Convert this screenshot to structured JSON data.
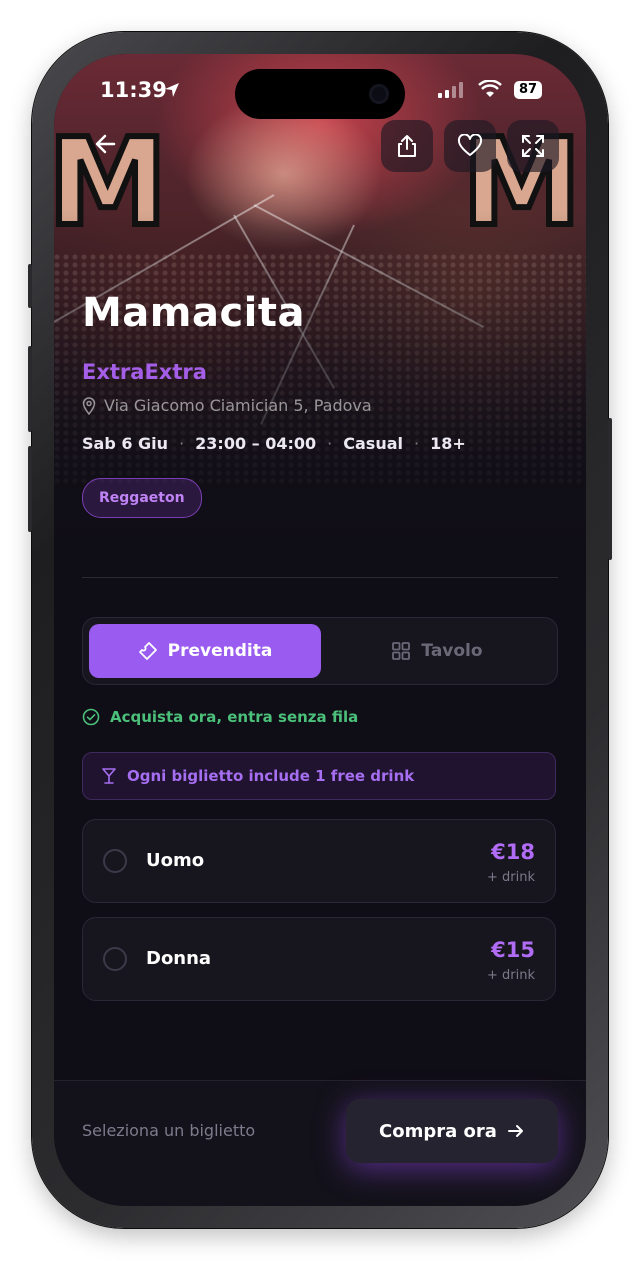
{
  "status_bar": {
    "time": "11:39",
    "battery": "87"
  },
  "event": {
    "title": "Mamacita",
    "venue": "ExtraExtra",
    "address": "Via Giacomo Ciamician 5, Padova",
    "date": "Sab 6 Giu",
    "time_range": "23:00 – 04:00",
    "dress_code": "Casual",
    "age": "18+",
    "genre": "Reggaeton",
    "separator": "·"
  },
  "tabs": {
    "active_label": "Prevendita",
    "inactive_label": "Tavolo"
  },
  "notice": "Acquista ora, entra senza fila",
  "drink_banner": "Ogni biglietto include 1 free drink",
  "tickets": [
    {
      "label": "Uomo",
      "price": "€18",
      "sub": "+ drink"
    },
    {
      "label": "Donna",
      "price": "€15",
      "sub": "+ drink"
    }
  ],
  "footer": {
    "hint": "Seleziona un biglietto",
    "buy_label": "Compra ora"
  },
  "colors": {
    "accent": "#9a5cf0",
    "venue": "#a55ee8",
    "success": "#4bc07a",
    "background": "#0f0d15"
  },
  "icons": {
    "back": "arrow-left-icon",
    "share": "share-icon",
    "favorite": "heart-icon",
    "expand": "expand-icon",
    "location": "map-pin-icon",
    "ticket": "ticket-icon",
    "table": "grid-icon",
    "check": "check-circle-icon",
    "drink": "cocktail-icon",
    "arrow": "arrow-right-icon"
  }
}
